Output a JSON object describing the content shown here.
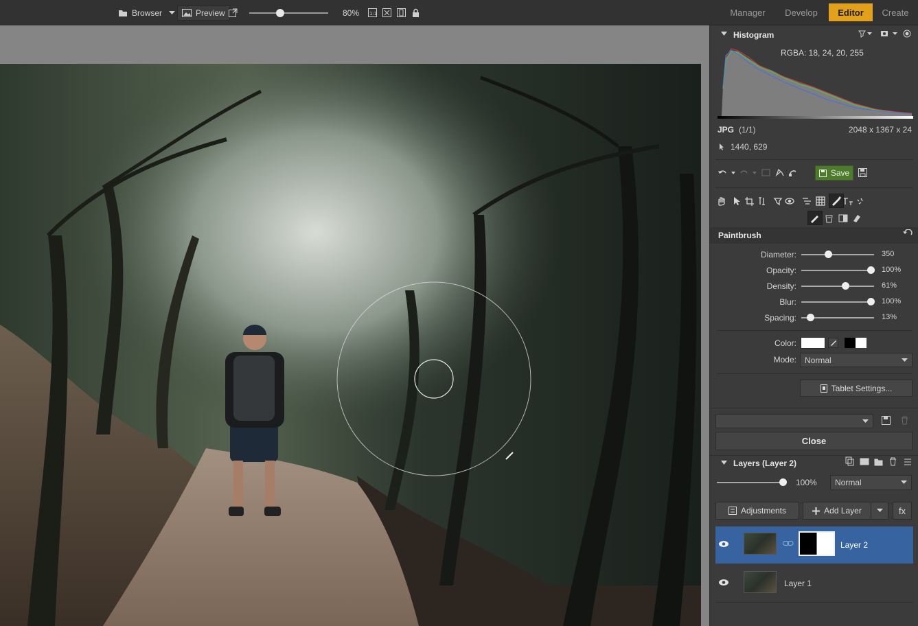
{
  "toolbar": {
    "browser_label": "Browser",
    "preview_label": "Preview",
    "zoom_value": "80%",
    "zoom_fraction": 0.38,
    "modes": [
      {
        "label": "Manager",
        "active": false
      },
      {
        "label": "Develop",
        "active": false
      },
      {
        "label": "Editor",
        "active": true
      },
      {
        "label": "Create",
        "active": false
      }
    ]
  },
  "histogram": {
    "title": "Histogram",
    "rgba": "RGBA:  18,  24,  20, 255",
    "format": "JPG",
    "count": "(1/1)",
    "dimensions": "2048 x 1367 x 24",
    "cursor_pos": "1440, 629"
  },
  "actions": {
    "save_label": "Save"
  },
  "paintbrush": {
    "title": "Paintbrush",
    "sliders": [
      {
        "label": "Diameter:",
        "value": "350",
        "fraction": 0.37
      },
      {
        "label": "Opacity:",
        "value": "100%",
        "fraction": 0.96
      },
      {
        "label": "Density:",
        "value": "61%",
        "fraction": 0.61
      },
      {
        "label": "Blur:",
        "value": "100%",
        "fraction": 0.96
      },
      {
        "label": "Spacing:",
        "value": "13%",
        "fraction": 0.13
      }
    ],
    "color_label": "Color:",
    "mode_label": "Mode:",
    "mode_value": "Normal",
    "tablet_label": "Tablet Settings...",
    "close_label": "Close"
  },
  "layers": {
    "title": "Layers (Layer 2)",
    "opacity": "100%",
    "opacity_fraction": 0.96,
    "blend_mode": "Normal",
    "adjustments_label": "Adjustments",
    "add_layer_label": "Add Layer",
    "fx_label": "fx",
    "items": [
      {
        "name": "Layer 2",
        "selected": true
      },
      {
        "name": "Layer 1",
        "selected": false
      }
    ]
  },
  "colors": {
    "accent": "#e3a11a",
    "save_green": "#4e7a2e",
    "selected_layer": "#3764a0"
  }
}
